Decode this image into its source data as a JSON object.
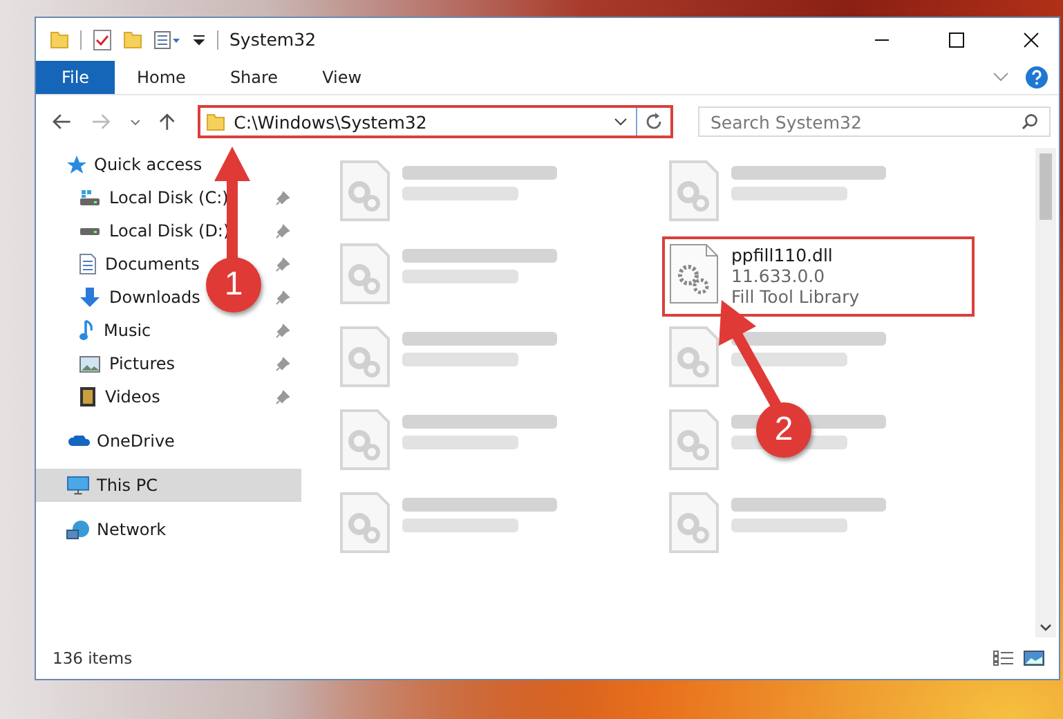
{
  "window": {
    "title": "System32"
  },
  "ribbon": [
    {
      "label": "File",
      "kind": "menu"
    },
    {
      "label": "Home",
      "kind": "tab"
    },
    {
      "label": "Share",
      "kind": "tab"
    },
    {
      "label": "View",
      "kind": "tab"
    }
  ],
  "address": {
    "path": "C:\\Windows\\System32"
  },
  "search": {
    "placeholder": "Search System32"
  },
  "sidebar": {
    "items": [
      {
        "label": "Quick access",
        "selected": false,
        "children": [
          {
            "label": "Local Disk (C:)",
            "pinned": true,
            "selected": false
          },
          {
            "label": "Local Disk (D:)",
            "pinned": true,
            "selected": false
          },
          {
            "label": "Documents",
            "pinned": true,
            "selected": false
          },
          {
            "label": "Downloads",
            "pinned": true,
            "selected": false
          },
          {
            "label": "Music",
            "pinned": true,
            "selected": false
          },
          {
            "label": "Pictures",
            "pinned": true,
            "selected": false
          },
          {
            "label": "Videos",
            "pinned": true,
            "selected": false
          }
        ]
      },
      {
        "label": "OneDrive",
        "selected": false
      },
      {
        "label": "This PC",
        "selected": true
      },
      {
        "label": "Network",
        "selected": false
      }
    ]
  },
  "files": [
    {
      "blurred": true
    },
    {
      "blurred": true
    },
    {
      "blurred": true
    },
    {
      "name": "ppfill110.dll",
      "details": [
        "11.633.0.0",
        "Fill Tool Library"
      ],
      "blurred": false
    },
    {
      "blurred": true
    },
    {
      "blurred": true
    },
    {
      "blurred": true
    },
    {
      "blurred": true
    },
    {
      "blurred": true
    },
    {
      "blurred": true
    }
  ],
  "annotations": [
    {
      "number": "1"
    },
    {
      "number": "2"
    }
  ],
  "status_bar": {
    "item_count": "136 items"
  }
}
